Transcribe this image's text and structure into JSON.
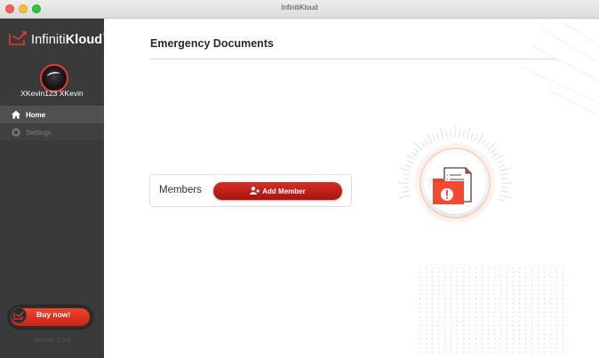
{
  "window": {
    "title": "InfinitiKloud"
  },
  "sidebar": {
    "brand_prefix": "Infiniti",
    "brand_bold": "Kloud",
    "brand_mark": "®",
    "username": "XKevin123 XKevin",
    "nav": [
      {
        "label": "Home",
        "icon": "home-icon",
        "active": true
      },
      {
        "label": "Settings",
        "icon": "gear-icon",
        "active": false
      }
    ],
    "buy_label": "Buy now!",
    "version": "Version 2.0.0"
  },
  "main": {
    "title": "Emergency Documents",
    "members_label": "Members",
    "add_member_label": "Add Member"
  },
  "colors": {
    "accent_red": "#c92314",
    "sidebar_bg": "#3a3a3a",
    "active_nav_bg": "#505050"
  }
}
